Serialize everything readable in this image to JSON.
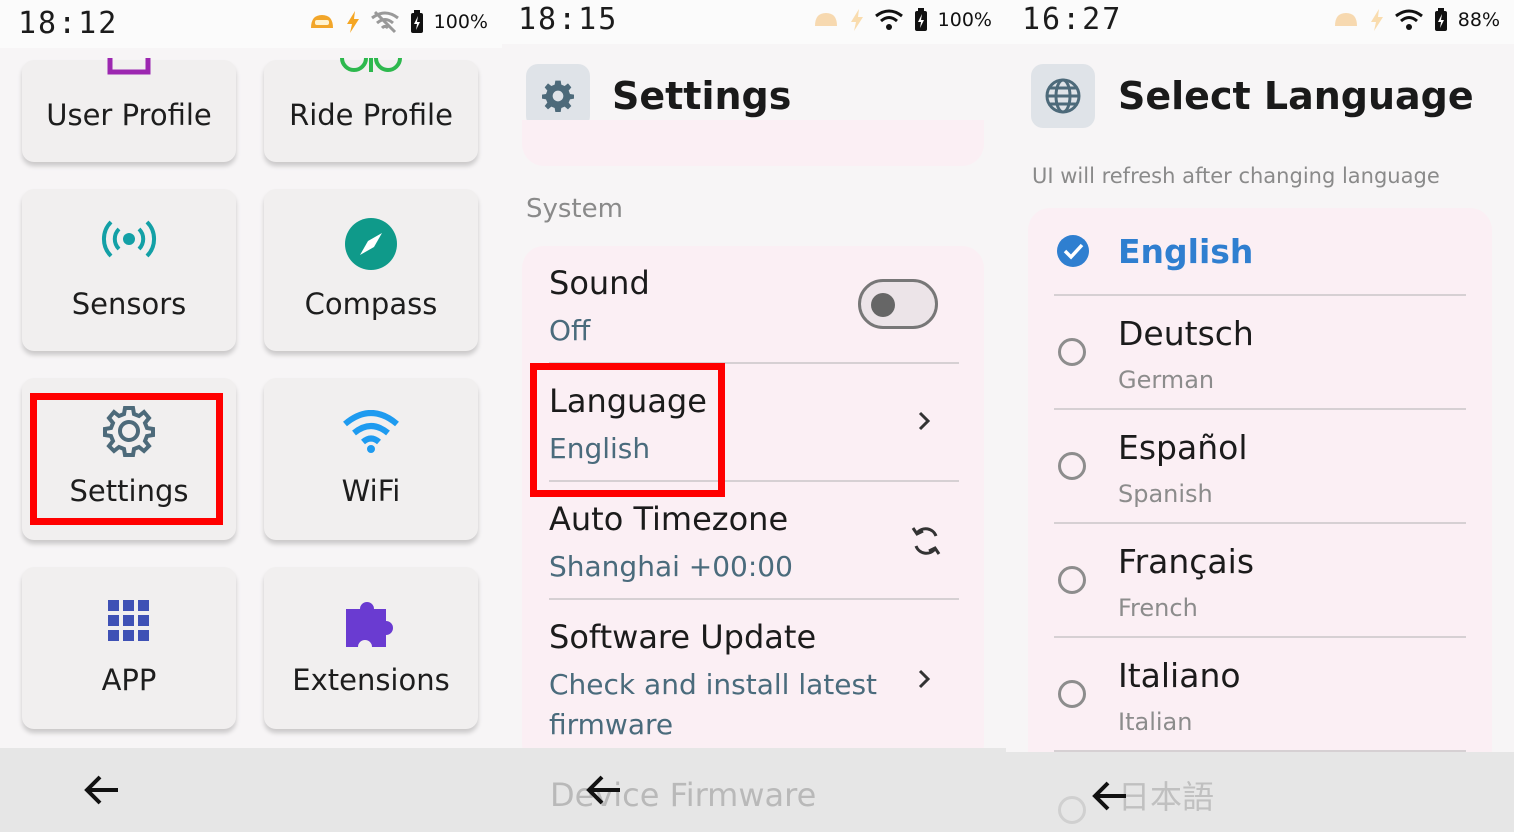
{
  "panel1": {
    "time": "18:12",
    "battery": "100%",
    "tiles": [
      {
        "label": "User Profile",
        "icon": "user-profile-icon"
      },
      {
        "label": "Ride Profile",
        "icon": "bike-icon"
      },
      {
        "label": "Sensors",
        "icon": "sensors-icon"
      },
      {
        "label": "Compass",
        "icon": "compass-icon"
      },
      {
        "label": "Settings",
        "icon": "gear-icon",
        "highlighted": true
      },
      {
        "label": "WiFi",
        "icon": "wifi-icon"
      },
      {
        "label": "APP",
        "icon": "grid-icon"
      },
      {
        "label": "Extensions",
        "icon": "puzzle-icon"
      }
    ],
    "highlight_color": "#ff0000"
  },
  "panel2": {
    "time": "18:15",
    "battery": "100%",
    "title": "Settings",
    "section": "System",
    "rows": [
      {
        "title": "Sound",
        "subtitle": "Off",
        "control": "toggle",
        "toggle_on": false
      },
      {
        "title": "Language",
        "subtitle": "English",
        "control": "chevron",
        "highlighted": true
      },
      {
        "title": "Auto Timezone",
        "subtitle": "Shanghai +00:00",
        "control": "sync-icon"
      },
      {
        "title": "Software Update",
        "subtitle_line1": "Check and install latest",
        "subtitle_line2": "firmware",
        "control": "chevron"
      }
    ],
    "faded_next": "Device Firmware"
  },
  "panel3": {
    "time": "16:27",
    "battery": "88%",
    "title": "Select Language",
    "hint": "UI will refresh after changing language",
    "selected_color": "#2f7fd0",
    "languages": [
      {
        "name": "English",
        "selected": true
      },
      {
        "name": "Deutsch",
        "english": "German"
      },
      {
        "name": "Español",
        "english": "Spanish"
      },
      {
        "name": "Français",
        "english": "French"
      },
      {
        "name": "Italiano",
        "english": "Italian"
      }
    ],
    "faded_next": "日本語"
  }
}
